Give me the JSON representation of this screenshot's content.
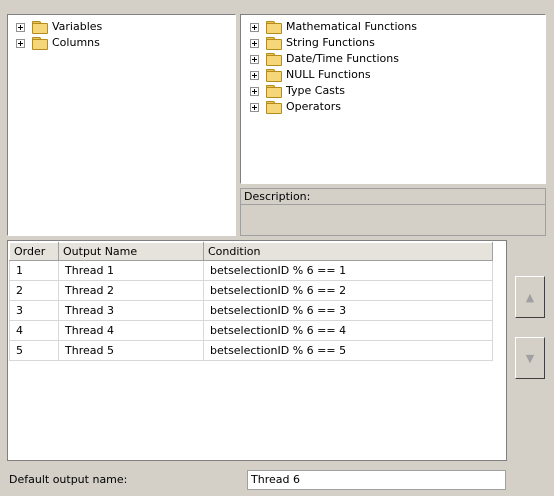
{
  "left_tree": {
    "items": [
      {
        "label": "Variables",
        "icon": "folder-icon"
      },
      {
        "label": "Columns",
        "icon": "folder-icon"
      }
    ]
  },
  "right_tree": {
    "items": [
      {
        "label": "Mathematical Functions",
        "icon": "folder-icon"
      },
      {
        "label": "String Functions",
        "icon": "folder-icon"
      },
      {
        "label": "Date/Time Functions",
        "icon": "folder-icon"
      },
      {
        "label": "NULL Functions",
        "icon": "folder-icon"
      },
      {
        "label": "Type Casts",
        "icon": "folder-icon"
      },
      {
        "label": "Operators",
        "icon": "folder-icon"
      }
    ]
  },
  "description": {
    "header": "Description:"
  },
  "grid": {
    "columns": [
      "Order",
      "Output Name",
      "Condition"
    ],
    "rows": [
      [
        "1",
        "Thread 1",
        "betselectionID % 6 == 1"
      ],
      [
        "2",
        "Thread 2",
        "betselectionID % 6 == 2"
      ],
      [
        "3",
        "Thread 3",
        "betselectionID % 6 == 3"
      ],
      [
        "4",
        "Thread 4",
        "betselectionID % 6 == 4"
      ],
      [
        "5",
        "Thread 5",
        "betselectionID % 6 == 5"
      ]
    ]
  },
  "buttons": {
    "move_up": "▲",
    "move_down": "▼"
  },
  "default_output": {
    "label": "Default output name:",
    "value": "Thread 6"
  }
}
